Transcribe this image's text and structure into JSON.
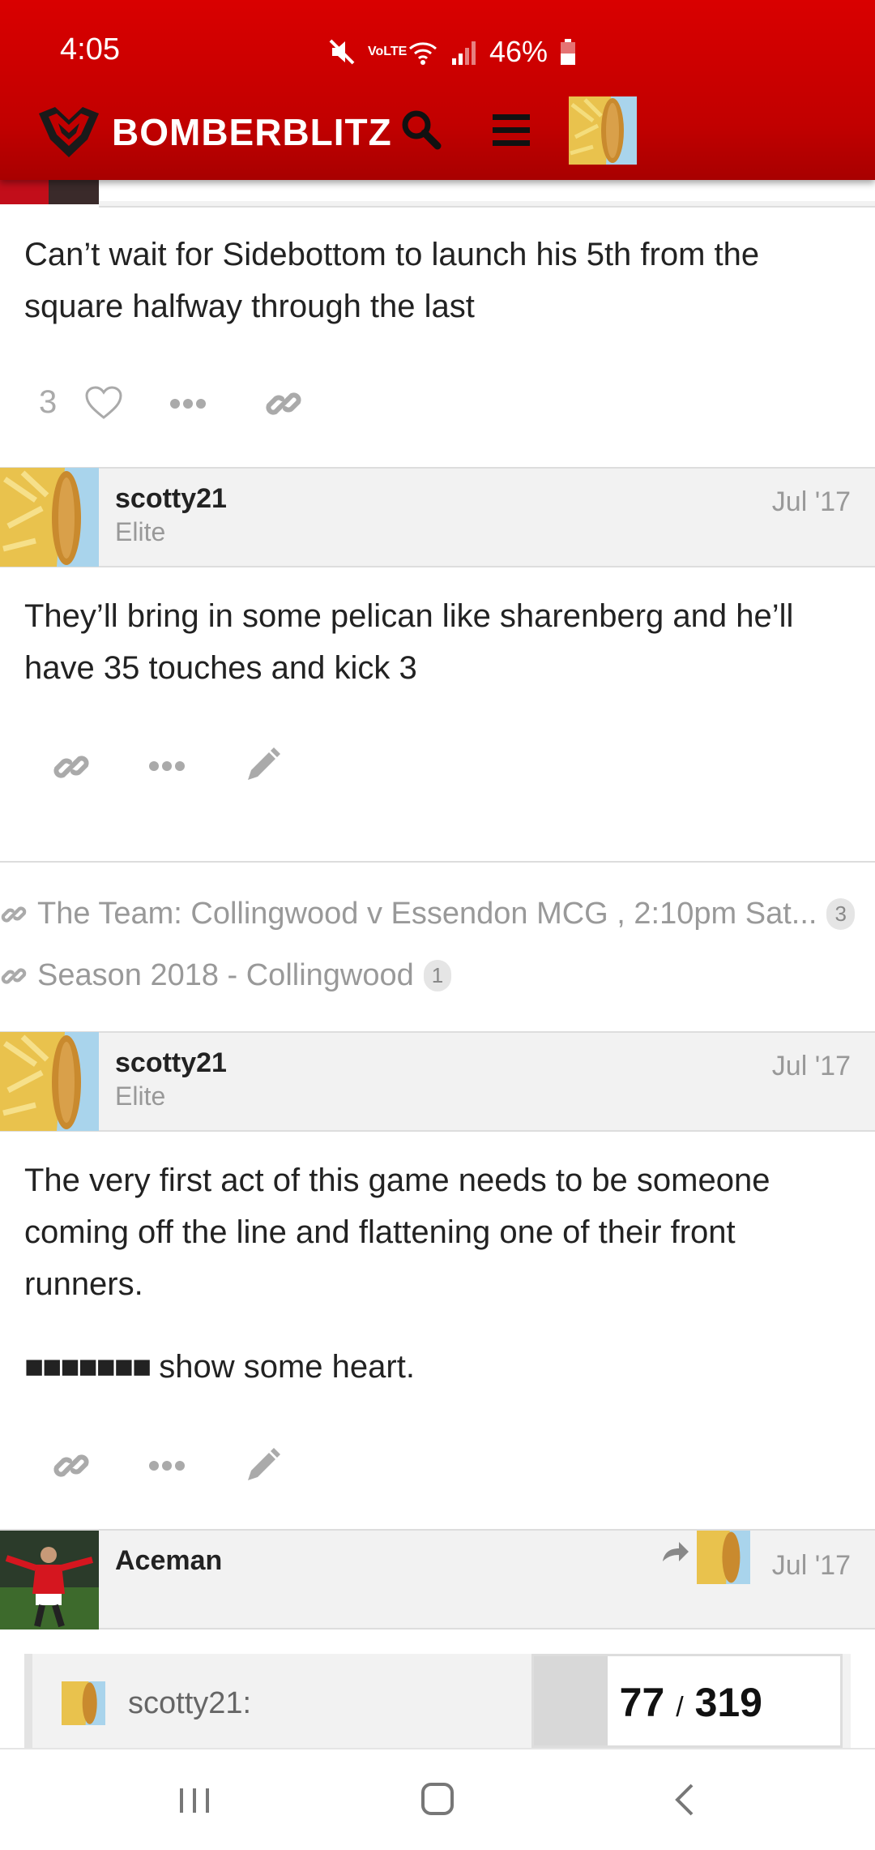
{
  "status_bar": {
    "time": "4:05",
    "battery": "46%",
    "lte_label": "VoLTE"
  },
  "header": {
    "brand": "BOMBERBLITZ"
  },
  "posts": [
    {
      "text": "Can’t wait for Sidebottom to launch his 5th from the square halfway through the last",
      "likes": "3"
    },
    {
      "username": "scotty21",
      "title": "Elite",
      "date": "Jul '17",
      "text": "They’ll bring in some pelican like sharenberg and he’ll have 35 touches and kick 3"
    },
    {
      "username": "scotty21",
      "title": "Elite",
      "date": "Jul '17",
      "text": "The very first act of this game needs to be someone coming off the line and flattening one of their front runners.",
      "text2_masked": "■■■■■■■",
      "text2": "show some heart."
    },
    {
      "username": "Aceman",
      "date": "Jul '17",
      "quote_user": "scotty21:"
    }
  ],
  "links": [
    {
      "label": "The Team: Collingwood v Essendon MCG , 2:10pm Sat...",
      "count": "3"
    },
    {
      "label": "Season 2018 - Collingwood",
      "count": "1"
    }
  ],
  "progress": {
    "current": "77",
    "separator": "/",
    "total": "319",
    "fraction": 0.24
  },
  "colors": {
    "brand_red": "#c10000",
    "muted": "#999999",
    "header_bg": "#f2f2f2"
  }
}
